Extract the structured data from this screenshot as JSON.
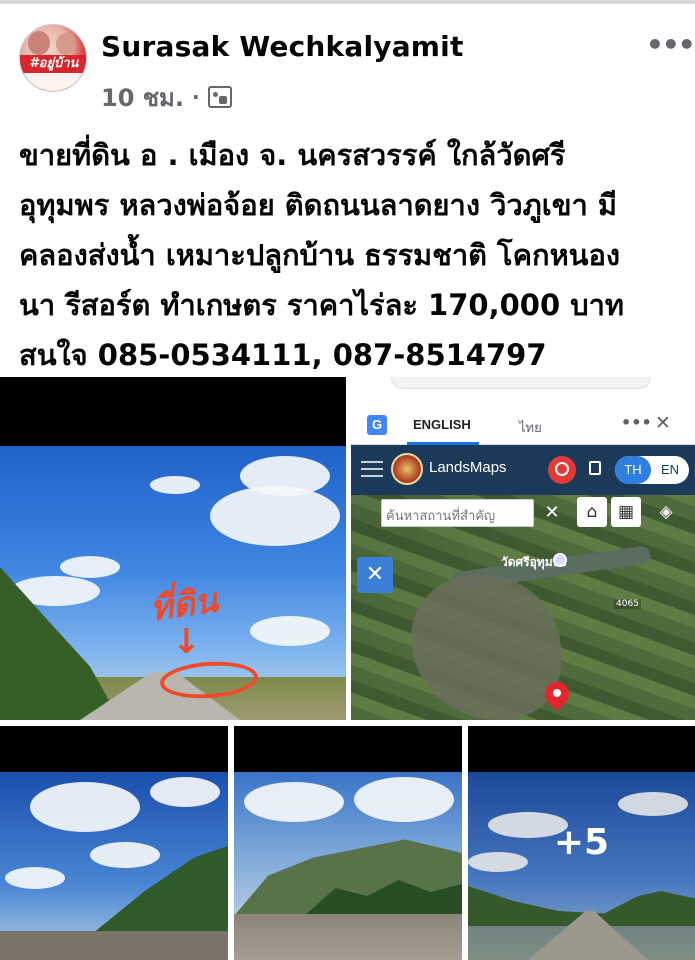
{
  "post": {
    "author": "Surasak Wechkalyamit",
    "time": "10 ชม.",
    "separator": "·",
    "audience_icon": "photo-audience-icon",
    "more_icon": "more-options-icon",
    "more_label": "•••",
    "text_lines": [
      "ขายที่ดิน อ . เมือง จ. นครสวรรค์ ใกล้วัดศรี",
      "อุทุมพร หลวงพ่อจ้อย ติดถนนลาดยาง วิวภูเขา มี",
      "คลองส่งน้ำ เหมาะปลูกบ้าน ธรรมชาติ โคกหนอง",
      "นา รีสอร์ต ทำเกษตร  ราคาไร่ละ 170,000 บาท",
      "สนใจ 085-0534111, 087-8514797"
    ]
  },
  "avatar": {
    "badge_text": "#อยู่บ้าน"
  },
  "photo1": {
    "annotation_text": "ที่ดิน",
    "arrow_text": "↓"
  },
  "photo2": {
    "tab_english": "ENGLISH",
    "tab_thai": "ไทย",
    "translate_icon_text": "G",
    "app_title": "LandsMaps",
    "lang_th": "TH",
    "lang_en": "EN",
    "search_placeholder": "ค้นหาสถานที่สำคัญ",
    "close_symbol": "✕",
    "home_symbol": "⌂",
    "grid_symbol": "▦",
    "layers_symbol": "◈",
    "tool_symbol": "✕",
    "place_label": "วัดศรีอุทุมพร",
    "road_label": "4065",
    "tab_more": "•••",
    "tab_close": "✕"
  },
  "photo5": {
    "more_count": "+5"
  },
  "colors": {
    "text": "#050505",
    "meta": "#65676b",
    "annotation": "#ef4b2a",
    "landsmaps_bar": "#1b3a5a",
    "toggle_active": "#2f7fe0",
    "pin": "#e3262b"
  }
}
